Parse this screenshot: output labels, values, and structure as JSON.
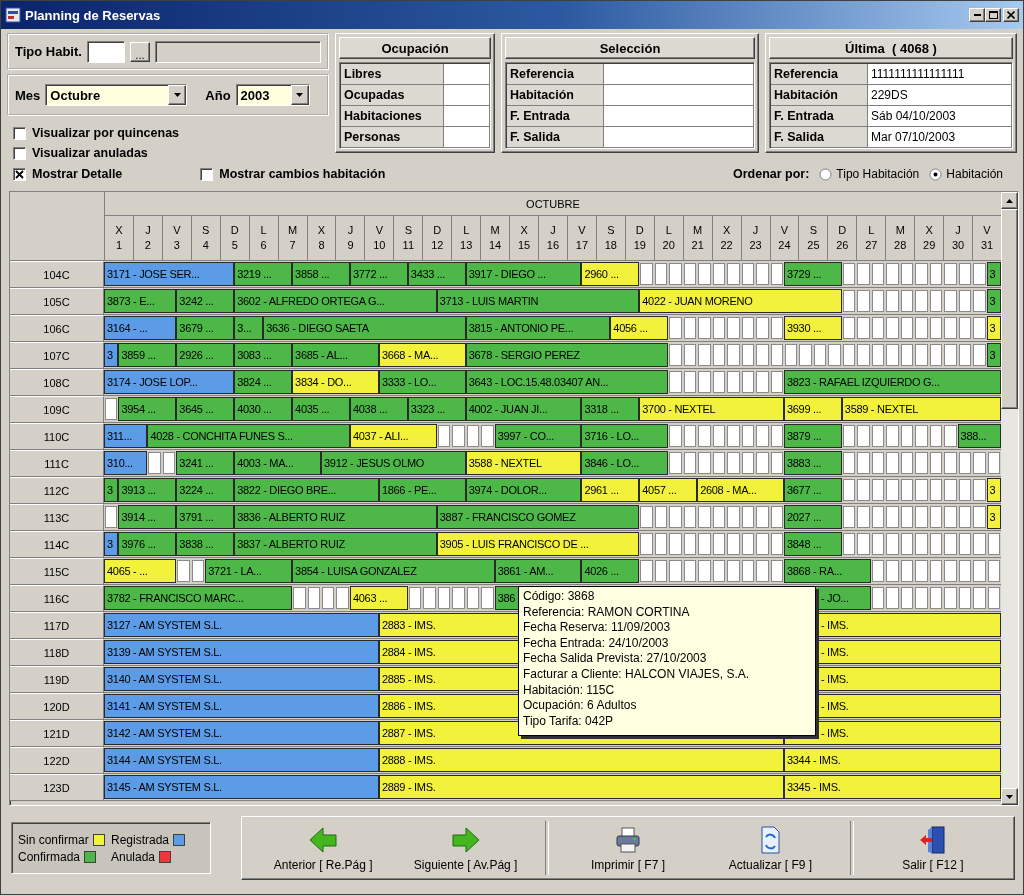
{
  "window": {
    "title": "Planning de Reservas"
  },
  "filters": {
    "tipo_habit": {
      "label": "Tipo Habit."
    },
    "browse_button": "...",
    "mes": {
      "label": "Mes",
      "value": "Octubre"
    },
    "ano": {
      "label": "Año",
      "value": "2003"
    }
  },
  "options": [
    {
      "label": "Visualizar por quincenas",
      "checked": false
    },
    {
      "label": "Visualizar anuladas",
      "checked": false
    },
    {
      "label": "Mostrar Detalle",
      "checked": true
    },
    {
      "label": "Mostrar cambios habitación",
      "checked": false
    }
  ],
  "panels": [
    {
      "title": "Ocupación",
      "rows": [
        {
          "label": "Libres"
        },
        {
          "label": "Ocupadas"
        },
        {
          "label": "Habitaciones"
        },
        {
          "label": "Personas"
        }
      ]
    },
    {
      "title": "Selección",
      "rows": [
        {
          "label": "Referencia"
        },
        {
          "label": "Habitación"
        },
        {
          "label": "F. Entrada"
        },
        {
          "label": "F. Salida"
        }
      ]
    },
    {
      "title": "Última  ( 4068 )",
      "rows": [
        {
          "label": "Referencia",
          "value": "1111111111111111"
        },
        {
          "label": "Habitación",
          "value": "229DS"
        },
        {
          "label": "F. Entrada",
          "value": "Sáb 04/10/2003"
        },
        {
          "label": "F. Salida",
          "value": "Mar 07/10/2003"
        }
      ]
    }
  ],
  "sort": {
    "label": "Ordenar por:",
    "options": [
      {
        "label": "Tipo Habitación",
        "selected": false
      },
      {
        "label": "Habitación",
        "selected": true
      }
    ]
  },
  "grid": {
    "month": "OCTUBRE",
    "days": [
      {
        "weekday": "X",
        "day": "1"
      },
      {
        "weekday": "J",
        "day": "2"
      },
      {
        "weekday": "V",
        "day": "3"
      },
      {
        "weekday": "S",
        "day": "4"
      },
      {
        "weekday": "D",
        "day": "5"
      },
      {
        "weekday": "L",
        "day": "6"
      },
      {
        "weekday": "M",
        "day": "7"
      },
      {
        "weekday": "X",
        "day": "8"
      },
      {
        "weekday": "J",
        "day": "9"
      },
      {
        "weekday": "V",
        "day": "10"
      },
      {
        "weekday": "S",
        "day": "11"
      },
      {
        "weekday": "D",
        "day": "12"
      },
      {
        "weekday": "L",
        "day": "13"
      },
      {
        "weekday": "M",
        "day": "14"
      },
      {
        "weekday": "X",
        "day": "15"
      },
      {
        "weekday": "J",
        "day": "16"
      },
      {
        "weekday": "V",
        "day": "17"
      },
      {
        "weekday": "S",
        "day": "18"
      },
      {
        "weekday": "D",
        "day": "19"
      },
      {
        "weekday": "L",
        "day": "20"
      },
      {
        "weekday": "M",
        "day": "21"
      },
      {
        "weekday": "X",
        "day": "22"
      },
      {
        "weekday": "J",
        "day": "23"
      },
      {
        "weekday": "V",
        "day": "24"
      },
      {
        "weekday": "S",
        "day": "25"
      },
      {
        "weekday": "D",
        "day": "26"
      },
      {
        "weekday": "L",
        "day": "27"
      },
      {
        "weekday": "M",
        "day": "28"
      },
      {
        "weekday": "X",
        "day": "29"
      },
      {
        "weekday": "J",
        "day": "30"
      },
      {
        "weekday": "V",
        "day": "31"
      }
    ],
    "rows": [
      {
        "room": "104C",
        "bookings": [
          {
            "text": "3171 - JOSE SER...",
            "color": "#5c9be6"
          },
          {
            "text": "3219 ...",
            "color": "#4db848"
          },
          {
            "text": "3858 ...",
            "color": "#4db848"
          },
          {
            "text": "3772 ...",
            "color": "#4db848"
          },
          {
            "text": "3433 ...",
            "color": "#4db848"
          },
          {
            "text": "3917 - DIEGO ...",
            "color": "#4db848"
          },
          {
            "text": "2960 ...",
            "color": "#f2f23c"
          },
          {
            "text": "3729 ...",
            "color": "#4db848"
          },
          {
            "text": "3",
            "color": "#4db848"
          }
        ]
      },
      {
        "room": "105C",
        "bookings": [
          {
            "text": "3873 - E...",
            "color": "#4db848"
          },
          {
            "text": "3242 ...",
            "color": "#4db848"
          },
          {
            "text": "3602 - ALFREDO ORTEGA G...",
            "color": "#4db848"
          },
          {
            "text": "3713 - LUIS MARTIN",
            "color": "#4db848"
          },
          {
            "text": "4022 - JUAN MORENO",
            "color": "#f2f23c"
          },
          {
            "text": "3",
            "color": "#4db848"
          }
        ]
      },
      {
        "room": "106C",
        "bookings": [
          {
            "text": "3164 - ...",
            "color": "#5c9be6"
          },
          {
            "text": "3679 ...",
            "color": "#4db848"
          },
          {
            "text": "3...",
            "color": "#4db848"
          },
          {
            "text": "3636 - DIEGO SAETA",
            "color": "#4db848"
          },
          {
            "text": "3815 - ANTONIO PE...",
            "color": "#4db848"
          },
          {
            "text": "4056 ...",
            "color": "#f2f23c"
          },
          {
            "text": "3930 ...",
            "color": "#f2f23c"
          },
          {
            "text": "3",
            "color": "#f2f23c"
          }
        ]
      },
      {
        "room": "107C",
        "bookings": [
          {
            "text": "3",
            "color": "#5c9be6"
          },
          {
            "text": "3859 ...",
            "color": "#4db848"
          },
          {
            "text": "2926 ...",
            "color": "#4db848"
          },
          {
            "text": "3083 ...",
            "color": "#4db848"
          },
          {
            "text": "3685 - AL...",
            "color": "#4db848"
          },
          {
            "text": "3668 - MA...",
            "color": "#f2f23c"
          },
          {
            "text": "3678 - SERGIO PEREZ",
            "color": "#4db848"
          },
          {
            "text": "3",
            "color": "#4db848"
          }
        ]
      },
      {
        "room": "108C",
        "bookings": [
          {
            "text": "3174 - JOSE LOP...",
            "color": "#5c9be6"
          },
          {
            "text": "3824 ...",
            "color": "#4db848"
          },
          {
            "text": "3834 - DO...",
            "color": "#f2f23c"
          },
          {
            "text": "3333 - LO...",
            "color": "#4db848"
          },
          {
            "text": "3643 - LOC.15.48.03407 AN...",
            "color": "#4db848"
          },
          {
            "text": "3823 - RAFAEL IZQUIERDO G...",
            "color": "#4db848"
          }
        ]
      },
      {
        "room": "109C",
        "bookings": [
          {
            "text": "3954 ...",
            "color": "#4db848"
          },
          {
            "text": "3645 ...",
            "color": "#4db848"
          },
          {
            "text": "4030 ...",
            "color": "#4db848"
          },
          {
            "text": "4035 ...",
            "color": "#4db848"
          },
          {
            "text": "4038 ...",
            "color": "#4db848"
          },
          {
            "text": "3323 ...",
            "color": "#4db848"
          },
          {
            "text": "4002 - JUAN JI...",
            "color": "#4db848"
          },
          {
            "text": "3318 ...",
            "color": "#4db848"
          },
          {
            "text": "3700 - NEXTEL",
            "color": "#f2f23c"
          },
          {
            "text": "3699 ...",
            "color": "#f2f23c"
          },
          {
            "text": "3589 - NEXTEL",
            "color": "#f2f23c"
          }
        ]
      },
      {
        "room": "110C",
        "bookings": [
          {
            "text": "311...",
            "color": "#5c9be6"
          },
          {
            "text": "4028 - CONCHITA FUNES S...",
            "color": "#4db848"
          },
          {
            "text": "4037 - ALI...",
            "color": "#f2f23c"
          },
          {
            "text": "3997 - CO...",
            "color": "#4db848"
          },
          {
            "text": "3716 - LO...",
            "color": "#4db848"
          },
          {
            "text": "3879 ...",
            "color": "#4db848"
          },
          {
            "text": "388...",
            "color": "#4db848"
          }
        ]
      },
      {
        "room": "111C",
        "bookings": [
          {
            "text": "310...",
            "color": "#5c9be6"
          },
          {
            "text": "3241 ...",
            "color": "#4db848"
          },
          {
            "text": "4003 - MA...",
            "color": "#4db848"
          },
          {
            "text": "3912 - JESUS OLMO",
            "color": "#4db848"
          },
          {
            "text": "3588 - NEXTEL",
            "color": "#f2f23c"
          },
          {
            "text": "3846 - LO...",
            "color": "#4db848"
          },
          {
            "text": "3883 ...",
            "color": "#4db848"
          }
        ]
      },
      {
        "room": "112C",
        "bookings": [
          {
            "text": "3",
            "color": "#4db848"
          },
          {
            "text": "3913 ...",
            "color": "#4db848"
          },
          {
            "text": "3224 ...",
            "color": "#4db848"
          },
          {
            "text": "3822 - DIEGO BRE...",
            "color": "#4db848"
          },
          {
            "text": "1866 - PE...",
            "color": "#4db848"
          },
          {
            "text": "3974 - DOLOR...",
            "color": "#4db848"
          },
          {
            "text": "2961 ...",
            "color": "#f2f23c"
          },
          {
            "text": "4057 ...",
            "color": "#f2f23c"
          },
          {
            "text": "2608 - MA...",
            "color": "#f2f23c"
          },
          {
            "text": "3677 ...",
            "color": "#4db848"
          },
          {
            "text": "3",
            "color": "#f2f23c"
          }
        ]
      },
      {
        "room": "113C",
        "bookings": [
          {
            "text": "3914 ...",
            "color": "#4db848"
          },
          {
            "text": "3791 ...",
            "color": "#4db848"
          },
          {
            "text": "3836 - ALBERTO RUIZ",
            "color": "#4db848"
          },
          {
            "text": "3887 - FRANCISCO GOMEZ",
            "color": "#4db848"
          },
          {
            "text": "2027 ...",
            "color": "#4db848"
          },
          {
            "text": "3",
            "color": "#f2f23c"
          }
        ]
      },
      {
        "room": "114C",
        "bookings": [
          {
            "text": "3",
            "color": "#5c9be6"
          },
          {
            "text": "3976 ...",
            "color": "#4db848"
          },
          {
            "text": "3838 ...",
            "color": "#4db848"
          },
          {
            "text": "3837 - ALBERTO RUIZ",
            "color": "#4db848"
          },
          {
            "text": "3905 - LUIS FRANCISCO DE ...",
            "color": "#f2f23c"
          },
          {
            "text": "3848 ...",
            "color": "#4db848"
          }
        ]
      },
      {
        "room": "115C",
        "bookings": [
          {
            "text": "4065 - ...",
            "color": "#f2f23c"
          },
          {
            "text": "3721 - LA...",
            "color": "#4db848"
          },
          {
            "text": "3854 - LUISA GONZALEZ",
            "color": "#4db848"
          },
          {
            "text": "3861 - AM...",
            "color": "#4db848"
          },
          {
            "text": "4026 ...",
            "color": "#4db848"
          },
          {
            "text": "3868 - RA...",
            "color": "#4db848"
          }
        ]
      },
      {
        "room": "116C",
        "bookings": [
          {
            "text": "3782 - FRANCISCO MARC...",
            "color": "#4db848"
          },
          {
            "text": "4063 ...",
            "color": "#f2f23c"
          },
          {
            "text": "386",
            "color": "#4db848"
          },
          {
            "text": "- JO...",
            "color": "#4db848"
          }
        ]
      },
      {
        "room": "117D",
        "bookings": [
          {
            "text": "3127 - AM SYSTEM S.L.",
            "color": "#5c9be6"
          },
          {
            "text": "2883 - IMS.",
            "color": "#f2f23c"
          },
          {
            "text": "- IMS.",
            "color": "#f2f23c"
          }
        ]
      },
      {
        "room": "118D",
        "bookings": [
          {
            "text": "3139 - AM SYSTEM S.L.",
            "color": "#5c9be6"
          },
          {
            "text": "2884 - IMS.",
            "color": "#f2f23c"
          },
          {
            "text": "- IMS.",
            "color": "#f2f23c"
          }
        ]
      },
      {
        "room": "119D",
        "bookings": [
          {
            "text": "3140 - AM SYSTEM S.L.",
            "color": "#5c9be6"
          },
          {
            "text": "2885 - IMS.",
            "color": "#f2f23c"
          },
          {
            "text": "- IMS.",
            "color": "#f2f23c"
          }
        ]
      },
      {
        "room": "120D",
        "bookings": [
          {
            "text": "3141 - AM SYSTEM S.L.",
            "color": "#5c9be6"
          },
          {
            "text": "2886 - IMS.",
            "color": "#f2f23c"
          },
          {
            "text": "- IMS.",
            "color": "#f2f23c"
          }
        ]
      },
      {
        "room": "121D",
        "bookings": [
          {
            "text": "3142 - AM SYSTEM S.L.",
            "color": "#5c9be6"
          },
          {
            "text": "2887 - IMS.",
            "color": "#f2f23c"
          },
          {
            "text": "- IMS.",
            "color": "#f2f23c"
          }
        ]
      },
      {
        "room": "122D",
        "bookings": [
          {
            "text": "3144 - AM SYSTEM S.L.",
            "color": "#5c9be6"
          },
          {
            "text": "2888 - IMS.",
            "color": "#f2f23c"
          },
          {
            "text": "3344 - IMS.",
            "color": "#f2f23c"
          }
        ]
      },
      {
        "room": "123D",
        "bookings": [
          {
            "text": "3145 - AM SYSTEM S.L.",
            "color": "#5c9be6"
          },
          {
            "text": "2889 - IMS.",
            "color": "#f2f23c"
          },
          {
            "text": "3345 - IMS.",
            "color": "#f2f23c"
          }
        ]
      }
    ]
  },
  "tooltip": {
    "lines": [
      "Código: 3868",
      "Referencia: RAMON CORTINA",
      "Fecha Reserva: 11/09/2003",
      "Fecha Entrada: 24/10/2003",
      "Fecha Salida Prevista: 27/10/2003",
      "Facturar a Cliente: HALCON VIAJES, S.A.",
      "Habitación: 115C",
      "Ocupación: 6 Adultos",
      "Tipo Tarifa: 042P"
    ]
  },
  "legend": [
    {
      "label": "Sin confirmar",
      "color": "#f2f23c"
    },
    {
      "label": "Registrada",
      "color": "#5c9be6"
    },
    {
      "label": "Confirmada",
      "color": "#4db848"
    },
    {
      "label": "Anulada",
      "color": "#e83a3a"
    }
  ],
  "buttons": [
    {
      "label": "Anterior [ Re.Pág ]",
      "kind": "prev"
    },
    {
      "label": "Siguiente [ Av.Pág ]",
      "kind": "next"
    },
    {
      "label": "Imprimir [ F7 ]",
      "kind": "print"
    },
    {
      "label": "Actualizar [ F9 ]",
      "kind": "refresh"
    },
    {
      "label": "Salir [ F12 ]",
      "kind": "exit"
    }
  ]
}
